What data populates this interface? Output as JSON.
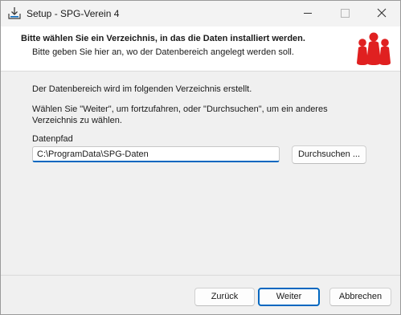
{
  "window": {
    "title": "Setup - SPG-Verein 4",
    "controls": {
      "minimize": "minimize",
      "maximize": "maximize",
      "close": "close"
    }
  },
  "header": {
    "title": "Bitte wählen Sie ein Verzeichnis, in das die Daten installiert werden.",
    "subtitle": "Bitte geben Sie hier an, wo der Datenbereich angelegt werden soll.",
    "logo_color": "#e02020"
  },
  "content": {
    "line1": "Der Datenbereich wird im folgenden Verzeichnis erstellt.",
    "line2a": "Wählen Sie \"Weiter\", um fortzufahren, oder \"Durchsuchen\", um ein anderes",
    "line2b": "Verzeichnis zu wählen.",
    "path_label": "Datenpfad",
    "path_value": "C:\\ProgramData\\SPG-Daten",
    "browse_label": "Durchsuchen ..."
  },
  "footer": {
    "back_label": "Zurück",
    "next_label": "Weiter",
    "cancel_label": "Abbrechen"
  },
  "colors": {
    "accent": "#0067c0",
    "logo": "#e02020"
  }
}
